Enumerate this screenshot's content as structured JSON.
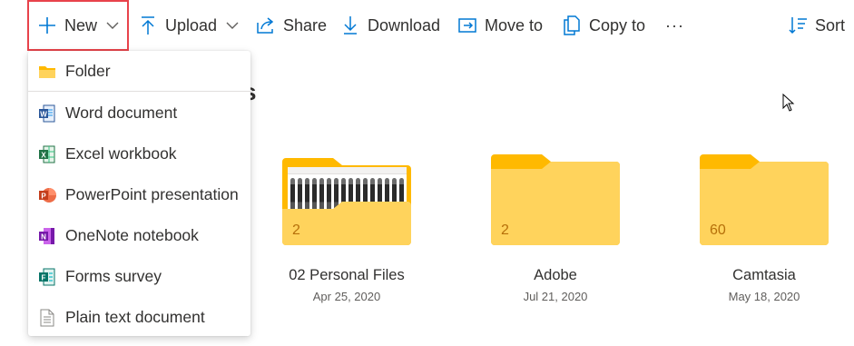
{
  "toolbar": {
    "new_label": "New",
    "upload_label": "Upload",
    "share_label": "Share",
    "download_label": "Download",
    "move_label": "Move to",
    "copy_label": "Copy to",
    "more_label": "···",
    "sort_label": "Sort",
    "icons": [
      "plus-icon",
      "chevron-down-icon",
      "upload-icon",
      "share-icon",
      "download-icon",
      "move-icon",
      "copy-icon",
      "sort-icon"
    ]
  },
  "new_menu": {
    "items": [
      {
        "label": "Folder",
        "icon": "folder-icon"
      },
      {
        "label": "Word document",
        "icon": "word-icon"
      },
      {
        "label": "Excel workbook",
        "icon": "excel-icon"
      },
      {
        "label": "PowerPoint presentation",
        "icon": "powerpoint-icon"
      },
      {
        "label": "OneNote notebook",
        "icon": "onenote-icon"
      },
      {
        "label": "Forms survey",
        "icon": "forms-icon"
      },
      {
        "label": "Plain text document",
        "icon": "text-file-icon"
      }
    ]
  },
  "page": {
    "heading_fragment": "s"
  },
  "folders": [
    {
      "name": "02 Personal Files",
      "date": "Apr 25, 2020",
      "count": "2"
    },
    {
      "name": "Adobe",
      "date": "Jul 21, 2020",
      "count": "2"
    },
    {
      "name": "Camtasia",
      "date": "May 18, 2020",
      "count": "60"
    }
  ],
  "colors": {
    "accent": "#0078d4",
    "highlight_border": "#e8434b",
    "folder_front": "#ffd35c",
    "folder_back": "#ffb900",
    "count_text": "#b6700a"
  }
}
